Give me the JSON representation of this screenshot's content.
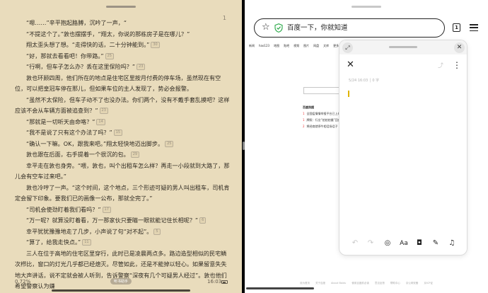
{
  "reader": {
    "chapter_num": "1",
    "paragraphs": [
      {
        "text": "“嗯……”辛平抱起胳膊，沉吟了一声，“",
        "cmt": ""
      },
      {
        "text": "“不提这个了。”敦也摆摆手，“翔太，你说的那栋房子是在哪儿？”",
        "cmt": ""
      },
      {
        "text": "翔太歪头想了想。“走得快的话，二十分钟能到。”",
        "cmt": "30"
      },
      {
        "text": "“好，那就去看看吧！你带路。”",
        "cmt": "25"
      },
      {
        "text": "“行啊，但车子怎么办？丢在这里保险吗？”",
        "cmt": "23"
      },
      {
        "text": "敦也环顾四周，他们所在的地点是住宅区里按月付费的停车场，虽然现在有空位，可以把皇冠车停在那儿，但如果车位的主人发现了，势必会报警。",
        "cmt": ""
      },
      {
        "text": "“虽然不太保险，但车子动不了也没办法。你们两个，没有不戴手套乱摸吧？这样应该不会从车辆方面被追查到？”",
        "cmt": "23"
      },
      {
        "text": "“那就是一切听天由命咯？”",
        "cmt": "14"
      },
      {
        "text": "“我不是说了只有这个办法了吗？”",
        "cmt": "15"
      },
      {
        "text": "“确认一下嘛。OK，跟我来吧。”翔太轻快地迈出脚步。",
        "cmt": "25"
      },
      {
        "text": "敦也跟在后面，右手提着一个很沉的包。",
        "cmt": "29"
      },
      {
        "text": "幸平走在敦也身旁。“喂，敦也，叫个出租车怎么样？再走一小段就到大路了，那儿会有空车过来吧。”",
        "cmt": ""
      },
      {
        "text": "敦也冷哼了一声。“这个时间，这个地点，三个形迹可疑的男人叫出租车，司机肯定会留下印象。要我们已的画像一公布，那就全完了。”",
        "cmt": ""
      },
      {
        "text": "“司机会使劲盯着我们看吗？”",
        "cmt": "17"
      },
      {
        "text": "“万一呢？就算没盯着看，万一那家伙只要瞄一眼就能记住长相呢？”",
        "cmt": "6"
      },
      {
        "text": "幸平犹犹豫豫地走了几步，小声说了句“对不起”。",
        "cmt": "5"
      },
      {
        "text": "“算了，给我走快点。”",
        "cmt": "11"
      },
      {
        "text": "三人在位于高地的住宅区里穿行，此时已是凌晨两点多。路边造型相似的民宅鳞次栉比，窗口的灯光几乎都已经熄灭。尽管如此，还是不能掉以轻心。如果留意失失地大声讲话，说不定就会被人听到，告诉警察“深夜有几个可疑男人经过”。敦也他们希望警察认为嫌",
        "cmt": ""
      }
    ],
    "progress": "0.72%",
    "assist_label": "听书助手",
    "time": "16:03"
  },
  "browser": {
    "search_placeholder": "百度一下，你就知道",
    "tab_count": "1",
    "web_nav": [
      "新闻",
      "hao123",
      "地图",
      "贴吧",
      "视频",
      "图片",
      "网盘",
      "文库",
      "更多"
    ],
    "hot_title": "百度热搜",
    "hot_items": [
      {
        "num": "1",
        "text": "全国疫情情举报平台已上线"
      },
      {
        "num": "1",
        "text": "牌照：行业“拍拍拍摄”回应"
      },
      {
        "num": "2",
        "text": "将经商就停牛相话场话子"
      }
    ],
    "footer_links": [
      "设为首页",
      "关于百度",
      "About Baidu",
      "使用百度前必读",
      "意见反馈",
      "帮助中心",
      "京公网安备",
      "京ICP证"
    ]
  },
  "notes": {
    "expand_glyph": "⤢",
    "close_glyph": "✕",
    "back_glyph": "✕",
    "share_glyph": "⤴",
    "more_glyph": "⋮",
    "meta": "5/24 16:03 │ 0 字",
    "toolbar": {
      "undo": "↶",
      "redo": "↷",
      "check": "◎",
      "text_format": "Aa",
      "camera": "◘",
      "pen": "✎",
      "mic": "♫"
    }
  }
}
